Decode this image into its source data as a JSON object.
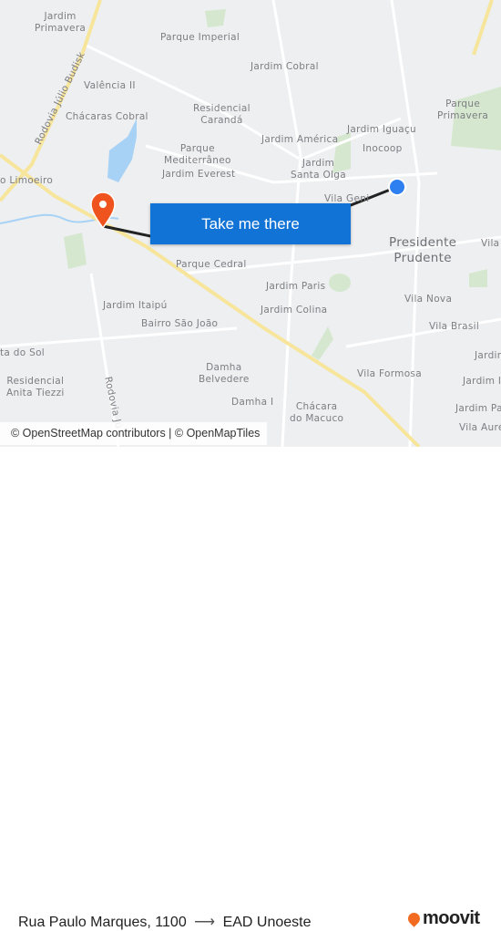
{
  "map": {
    "labels": {
      "jardim_primavera": "Jardim\nPrimavera",
      "parque_imperial": "Parque Imperial",
      "jardim_cobral": "Jardim Cobral",
      "valencia": "Valência II",
      "rodovia_budisk": "Rodovia Júlio Budisk",
      "chacaras_cobral": "Chácaras Cobral",
      "residencial_caranda": "Residencial\nCarandá",
      "jardim_iguacu": "Jardim Iguaçu",
      "parque_primavera": "Parque\nPrimavera",
      "jardim_america": "Jardim América",
      "inocoop": "Inocoop",
      "parque_mediterraneo": "Parque\nMediterrâneo",
      "jardim_everest": "Jardim Everest",
      "jardim_santa_olga": "Jardim\nSanta Olga",
      "limoeiro": "o Limoeiro",
      "vila_geni": "Vila Geni",
      "presidente_prudente": "Presidente\nPrudente",
      "vila": "Vila",
      "parque_cedral": "Parque Cedral",
      "jardim_paris": "Jardim Paris",
      "vila_nova": "Vila Nova",
      "jardim_itaipu": "Jardim Itaipú",
      "jardim_colina": "Jardim Colina",
      "vila_brasil": "Vila Brasil",
      "bairro_sao_joao": "Bairro São João",
      "sol": "ta do Sol",
      "jardim_r": "Jardim",
      "residencial_anita": "Residencial\nAnita Tiezzi",
      "rodovia_2": "Rodovia Jú",
      "damha_belvedere": "Damha\nBelvedere",
      "vila_formosa": "Vila Formosa",
      "jardim_r2": "Jardim I",
      "damha_i": "Damha I",
      "chacara_macuco": "Chácara\ndo Macuco",
      "jardim_pa": "Jardim Pa",
      "vila_aurelio": "Vila Aurélio"
    },
    "origin_color": "#2e7ff0",
    "destination_color": "#f0541e",
    "route_color": "#222222",
    "water_color": "#a8d2f5",
    "park_color": "#d5e8cf"
  },
  "attribution": "© OpenStreetMap contributors | © OpenMapTiles",
  "cta_label": "Take me there",
  "footer": {
    "origin": "Rua Paulo Marques, 1100",
    "arrow": "⟶",
    "destination": "EAD Unoeste",
    "brand": "moovit"
  }
}
